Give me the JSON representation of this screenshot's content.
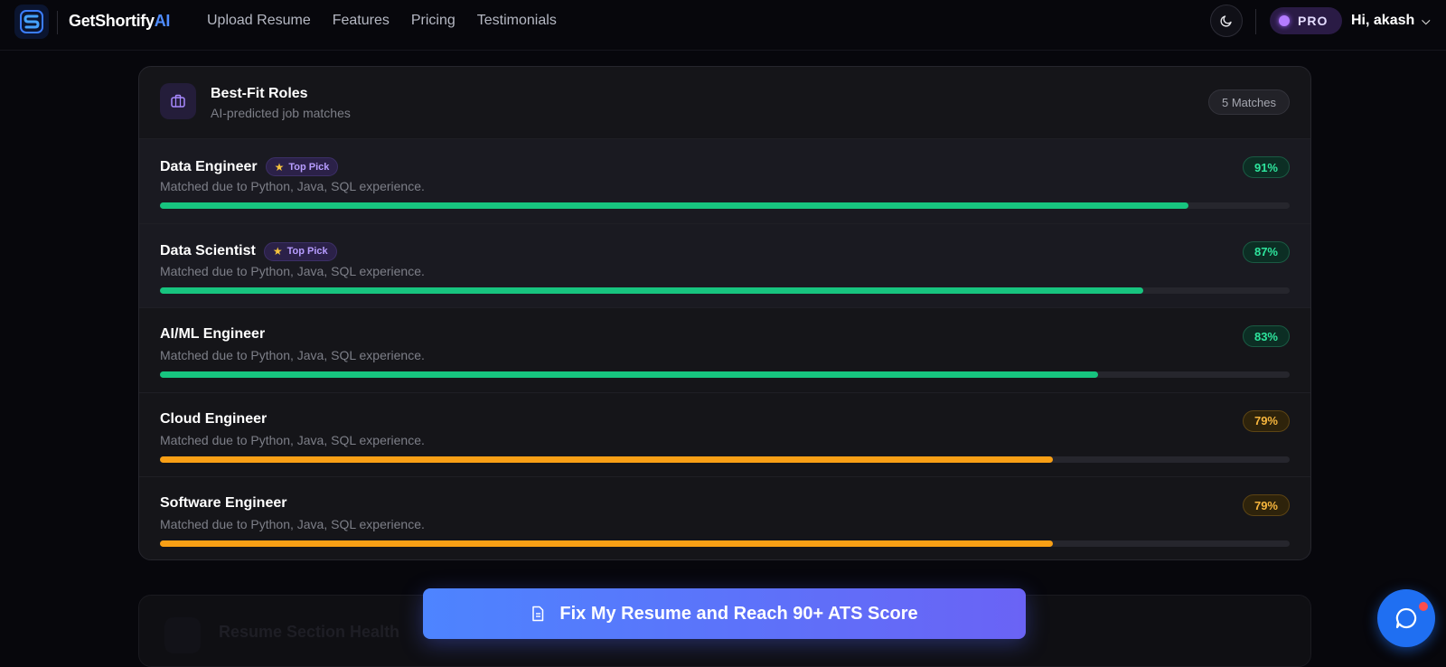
{
  "header": {
    "brand_main": "GetShortify",
    "brand_ai": "AI",
    "nav": [
      "Upload Resume",
      "Features",
      "Pricing",
      "Testimonials"
    ],
    "pro_label": "PRO",
    "greeting": "Hi, akash",
    "theme_icon": "moon-icon"
  },
  "best_fit": {
    "title": "Best-Fit Roles",
    "subtitle": "AI-predicted job matches",
    "matches_badge": "5 Matches",
    "top_pick_label": "Top Pick",
    "roles": [
      {
        "name": "Data Engineer",
        "reason": "Matched due to Python, Java, SQL experience.",
        "percent_label": "91%",
        "percent": 91,
        "top_pick": true,
        "tone": "green"
      },
      {
        "name": "Data Scientist",
        "reason": "Matched due to Python, Java, SQL experience.",
        "percent_label": "87%",
        "percent": 87,
        "top_pick": true,
        "tone": "green"
      },
      {
        "name": "AI/ML Engineer",
        "reason": "Matched due to Python, Java, SQL experience.",
        "percent_label": "83%",
        "percent": 83,
        "top_pick": false,
        "tone": "green"
      },
      {
        "name": "Cloud Engineer",
        "reason": "Matched due to Python, Java, SQL experience.",
        "percent_label": "79%",
        "percent": 79,
        "top_pick": false,
        "tone": "amber"
      },
      {
        "name": "Software Engineer",
        "reason": "Matched due to Python, Java, SQL experience.",
        "percent_label": "79%",
        "percent": 79,
        "top_pick": false,
        "tone": "amber"
      }
    ]
  },
  "next_section": {
    "title": "Resume Section Health"
  },
  "cta": {
    "label": "Fix My Resume and Reach 90+ ATS Score"
  },
  "colors": {
    "accent": "#4f8cff",
    "green": "#17c47f",
    "amber": "#f89f15",
    "pro": "#b47cff"
  }
}
